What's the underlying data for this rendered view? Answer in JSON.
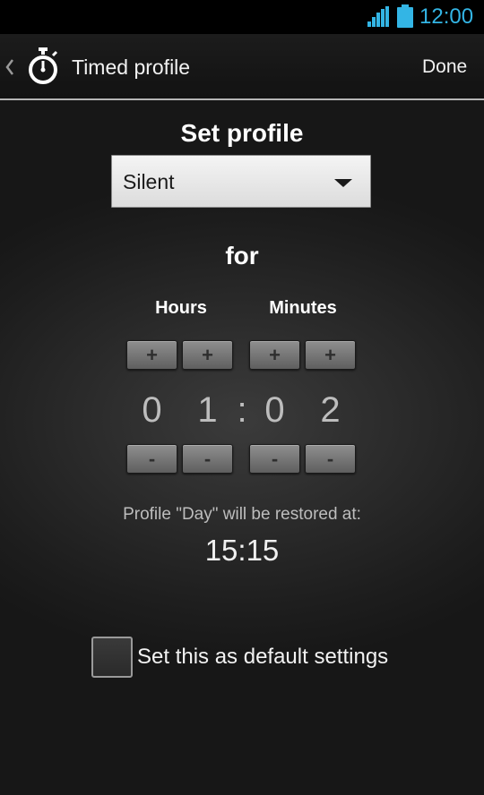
{
  "status_bar": {
    "time": "12:00",
    "accent_color": "#33b5e5",
    "signal_icon": "signal-icon",
    "battery_icon": "battery-icon"
  },
  "action_bar": {
    "title": "Timed profile",
    "done_label": "Done",
    "back_icon": "chevron-left-icon",
    "app_icon": "stopwatch-icon"
  },
  "profile": {
    "heading": "Set profile",
    "selected": "Silent",
    "for_label": "for"
  },
  "timer": {
    "hours_label": "Hours",
    "minutes_label": "Minutes",
    "plus_label": "+",
    "minus_label": "-",
    "digits": [
      "0",
      "1",
      "0",
      "2"
    ],
    "separator": ":"
  },
  "restore": {
    "text": "Profile \"Day\" will be restored at:",
    "time": "15:15"
  },
  "default_setting": {
    "label": "Set this as default settings",
    "checked": false
  }
}
